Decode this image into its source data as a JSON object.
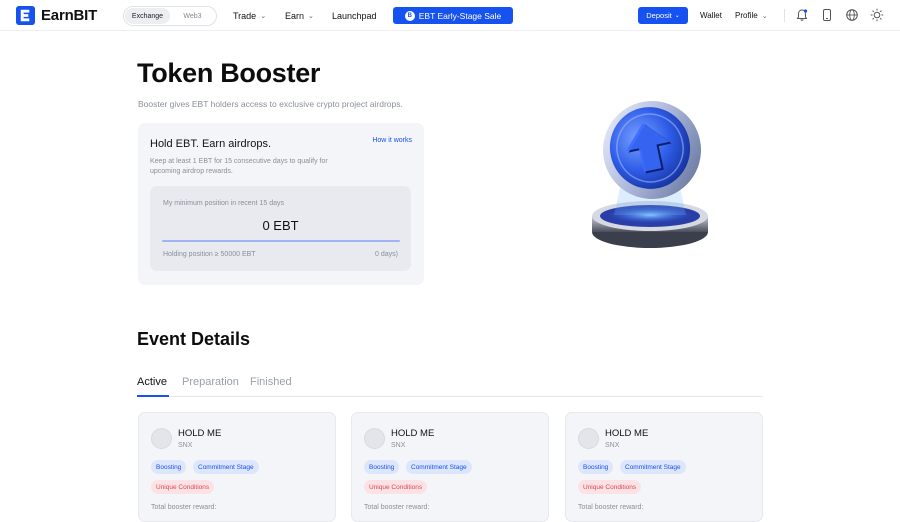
{
  "header": {
    "brand": "EarnBIT",
    "switch": [
      "Exchange",
      "Web3"
    ],
    "nav": {
      "trade": "Trade",
      "earn": "Earn",
      "launchpad": "Launchpad"
    },
    "sale_button": "EBT Early-Stage Sale",
    "sale_coin": "B",
    "deposit": "Deposit",
    "wallet": "Wallet",
    "profile": "Profile"
  },
  "hero": {
    "title": "Token Booster",
    "subtitle": "Booster gives EBT holders access to exclusive crypto project airdrops."
  },
  "booster_card": {
    "title": "Hold EBT. Earn airdrops.",
    "link": "How it works",
    "description": "Keep at least 1 EBT for 15 consecutive days to qualify for upcoming airdrop rewards.",
    "min_position_label": "My minimum position in recent 15 days",
    "min_position_value": "0 EBT",
    "holding_position": "Holding position ≥ 50000 EBT",
    "days": "0 days)"
  },
  "events": {
    "title": "Event Details",
    "tabs": [
      "Active",
      "Preparation",
      "Finished"
    ],
    "active_tab": "Active",
    "cards": [
      {
        "name": "HOLD ME",
        "token": "SNX",
        "tags": [
          "Boosting",
          "Commitment Stage"
        ],
        "warning": "Unique Conditions",
        "reward_label": "Total booster reward:"
      },
      {
        "name": "HOLD ME",
        "token": "SNX",
        "tags": [
          "Boosting",
          "Commitment Stage"
        ],
        "warning": "Unique Conditions",
        "reward_label": "Total booster reward:"
      },
      {
        "name": "HOLD ME",
        "token": "SNX",
        "tags": [
          "Boosting",
          "Commitment Stage"
        ],
        "warning": "Unique Conditions",
        "reward_label": "Total booster reward:"
      }
    ]
  },
  "icons": [
    "bell-icon",
    "phone-icon",
    "globe-icon",
    "sun-icon",
    "user-icon",
    "chevron-down-icon"
  ],
  "colors": {
    "accent": "#1652f0",
    "warning": "#e0464f",
    "card_bg": "#f4f5f8"
  }
}
